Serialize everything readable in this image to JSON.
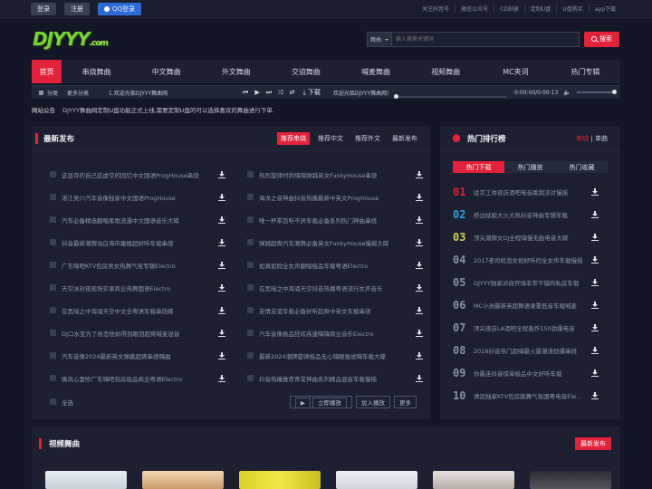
{
  "topbar": {
    "login": "登录",
    "register": "注册",
    "qq_login": "QQ登录",
    "links": [
      "关注抖音号",
      "微信公众号",
      "CD刻录",
      "定制U盘",
      "U盘购买",
      "app下载"
    ]
  },
  "header": {
    "logo_main": "DJYYY",
    "logo_suffix": ".com",
    "search_type": "舞曲",
    "search_placeholder": "输入搜索关键词",
    "search_button": "搜索"
  },
  "nav": [
    "首页",
    "串烧舞曲",
    "中文舞曲",
    "外文舞曲",
    "交谊舞曲",
    "喊麦舞曲",
    "视频舞曲",
    "MC夹词",
    "热门专辑"
  ],
  "player": {
    "category": "分类",
    "more": "更多分类",
    "current": "1.欢迎光临DJYYY舞曲网",
    "download": "下载",
    "now_playing": "欢迎光临DJYYY舞曲网!",
    "time": "0:00:00/0:00:13",
    "progress": 0
  },
  "notice": {
    "label": "网站公告",
    "text": "DJYYY舞曲网定制U盘功能正式上线,需要定制U盘的可以选择喜欢的舞曲进行下单."
  },
  "latest": {
    "title": "最新发布",
    "tabs": [
      "推荐串烧",
      "推荐中文",
      "推荐外文",
      "最新发布"
    ],
    "active_tab": 0,
    "songs": [
      "这显存的自己这虚空的回忆中文国语ProgHouse串烧",
      "热烈旋律时尚嗨嗨弹跳英文FunkyHouse串烧",
      "湛江吴川汽车音像独家中文国语ProgHouse",
      "海洋之音神曲抖音热播最新中英文ProgHouse",
      "汽车必备精选翻唱柔歌流瀑中文国语音乐大碟",
      "唯一杯茶百听不厌车载必备系列热门神曲串烧",
      "抖音最新潮牌浊白海市蜃楼超好听车载串烧",
      "弹跳超爽汽车潮牌必备英文FunkyHouse慢摇大碟",
      "广东嗨吧KTV包房男女热舞气氛专辑Electro",
      "如真如假全女声翻唱极品车载粤语Electro",
      "天空冰封夜现场实录商业热舞国语Electro",
      "在黑暗之中海涌天空抖音热播粤语流行女声音乐",
      "在黑暗之中海涌天空中文全粤语车载串烧碟",
      "友情友谊车载必备好听超爽中英文车载串烧",
      "DJ口水亚为了依恋他却得到眼泪超爽喊麦混音",
      "汽车音像极品狂欢高速嗨嗨商业音乐Electro",
      "汽车音像2024最新英文弹跳超爽串烧嗨曲",
      "最新2024潮牌旋律极品无心嗨眼独说嗨车载大碟",
      "晚风心里吹广东嗨吧包房极品商业粤语Electro",
      "抖音热播推荐青花神曲系列精品混音车载慢摇"
    ],
    "select_all": "全选",
    "actions": [
      "立即播放",
      "加入播放",
      "更多"
    ]
  },
  "ranking": {
    "title": "热门排行榜",
    "switch": [
      "串烧",
      "单曲"
    ],
    "switch_active": 0,
    "tabs": [
      "热门下载",
      "热门播放",
      "热门收藏"
    ],
    "active_tab": 0,
    "items": [
      {
        "num": "01",
        "title": "驻京工体夜店酒吧电音跳跳浓对慢摇"
      },
      {
        "num": "02",
        "title": "桥边姑娘大火大热抖音神曲专辑车载"
      },
      {
        "num": "03",
        "title": "顶尖潮牌女DJ全程嗨慢无敌电音大碟"
      },
      {
        "num": "04",
        "title": "2017老司机泡女很好听的全女声车载慢摇"
      },
      {
        "num": "05",
        "title": "DJYYY独家对自开场非常不错的私房车载"
      },
      {
        "num": "06",
        "title": "MC小洲最新英超舞语录重低音车载喊麦"
      },
      {
        "num": "07",
        "title": "顶尖夜店LA酒吧全程轰炸150劲爆电音"
      },
      {
        "num": "08",
        "title": "2018抖音热门超嗨最火最潮流劲爆串烧"
      },
      {
        "num": "09",
        "title": "你最走抖音惊单极品中文好听车载"
      },
      {
        "num": "10",
        "title": "清远独家KTV包房跳舞气氛国粤电音Electro"
      }
    ]
  },
  "video": {
    "title": "视频舞曲",
    "latest_button": "最新发布"
  },
  "colors": {
    "accent": "#e2213a",
    "background": "#131725",
    "panel": "#1c2030",
    "logo": "#7ad13a"
  }
}
